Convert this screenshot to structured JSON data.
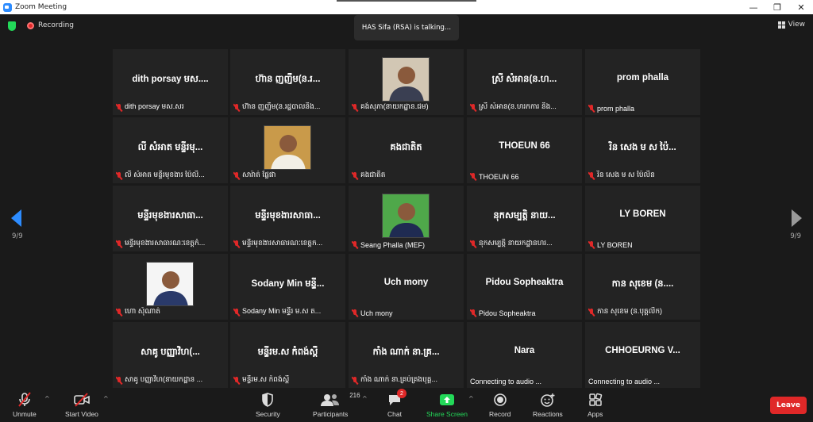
{
  "window": {
    "title": "Zoom Meeting",
    "controls": [
      "—",
      "❐",
      "✕"
    ]
  },
  "topbar": {
    "recording_label": "Recording",
    "talking": "HAS Sifa (RSA) is talking...",
    "view_label": "View"
  },
  "pager": {
    "left": "9/9",
    "right": "9/9"
  },
  "tiles": [
    {
      "big": "dith porsay មស....",
      "name": "dith porsay មស.សរ",
      "photo": false
    },
    {
      "big": "ហ៊ាន ញញឹម(ន.រ...",
      "name": "ហ៊ាន ញញឹម(ន.រដ្ឋបាលនិង...",
      "photo": false
    },
    {
      "big": "",
      "name": "គង់សុភា(នាយកដ្ឋាន.ជម)",
      "photo": true
    },
    {
      "big": "ស្រី សំអាន(ន.ហ...",
      "name": "ស្រី សំអាន(ន.ហរកការ និង...",
      "photo": false
    },
    {
      "big": "prom phalla",
      "name": "prom phalla",
      "photo": false
    },
    {
      "big": "លី សំអាត មន្ទីរមុ...",
      "name": "លី សំអាត មន្ទីរមុខងារ ប៉ៃលិ...",
      "photo": false
    },
    {
      "big": "",
      "name": "សារ៉ាត់ ផ្លែផា",
      "photo": true
    },
    {
      "big": "គងជាតិត",
      "name": "គងជាតិត",
      "photo": false
    },
    {
      "big": "THOEUN 66",
      "name": "THOEUN 66",
      "photo": false
    },
    {
      "big": "រិន សេង ម ស ប៉ៃ...",
      "name": "រិន សេង ម ស ប៉ៃលិន",
      "photo": false
    },
    {
      "big": "មន្ទីរមុខងារសាធា...",
      "name": "មន្ទីរមុខងារសាធារណៈខេត្តកំ...",
      "photo": false
    },
    {
      "big": "មន្ទីរមុខងារសាធា...",
      "name": "មន្ទីរមុខងារសាធារណៈខេត្តក...",
      "photo": false
    },
    {
      "big": "",
      "name": "Seang Phalla (MEF)",
      "photo": true
    },
    {
      "big": "នុកសម្បត្តិ នាយ...",
      "name": "នុកសម្បត្តិ នាយកដ្ឋានហរ...",
      "photo": false
    },
    {
      "big": "LY BOREN",
      "name": "LY BOREN",
      "photo": false
    },
    {
      "big": "",
      "name": "ហោ សុំណាត់",
      "photo": true
    },
    {
      "big": "Sodany  Min មន្ទី...",
      "name": "Sodany Min មន្ទីរ ម.ស ត...",
      "photo": false
    },
    {
      "big": "Uch mony",
      "name": "Uch mony",
      "photo": false
    },
    {
      "big": "Pidou Sopheaktra",
      "name": "Pidou Sopheaktra",
      "photo": false
    },
    {
      "big": "កាន សុខេម (ន....",
      "name": "កាន សុខេម (ន.បុគ្គលិក)",
      "photo": false
    },
    {
      "big": "សាគូ បញ្ញាវិហ(...",
      "name": "សាគូ បញ្ញាវិហ(នាយកដ្ឋាន ...",
      "photo": false
    },
    {
      "big": "មន្ទីរម.ស កំពង់ស្ពឺ",
      "name": "មន្ទីរម.ស កំពង់ស្ពឺ",
      "photo": false
    },
    {
      "big": "កាំង ណាក់ នា.គ្រ...",
      "name": "កាំង ណាក់ នា.គ្រប់គ្រងបុគ្គ...",
      "photo": false
    },
    {
      "big": "Nara",
      "name": "Connecting to audio ...",
      "photo": false,
      "connecting": true
    },
    {
      "big": "CHHOEURNG  V...",
      "name": "Connecting to audio ...",
      "photo": false,
      "connecting": true
    }
  ],
  "toolbar": {
    "unmute": "Unmute",
    "start_video": "Start Video",
    "security": "Security",
    "participants": "Participants",
    "participants_count": "216",
    "chat": "Chat",
    "chat_badge": "2",
    "share_screen": "Share Screen",
    "record": "Record",
    "reactions": "Reactions",
    "apps": "Apps",
    "leave": "Leave"
  },
  "colors": {
    "accent": "#2d8cff",
    "share": "#23d959",
    "leave": "#e02828",
    "muted": "#e02828"
  }
}
